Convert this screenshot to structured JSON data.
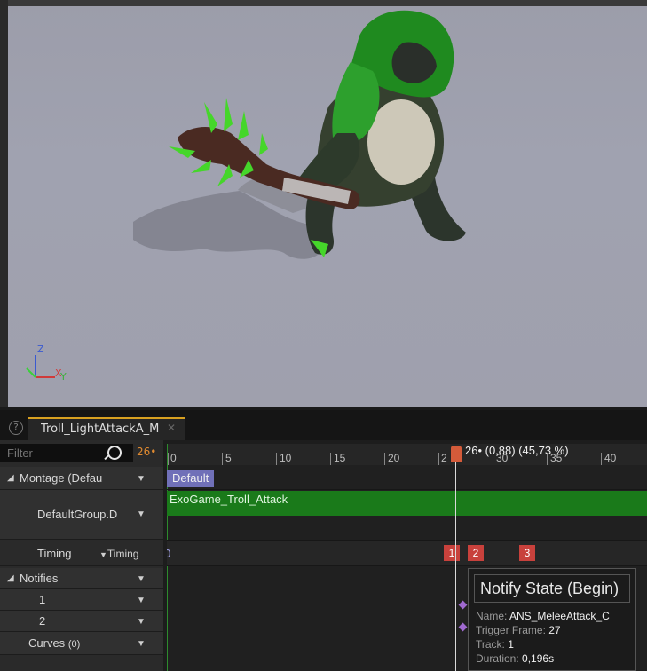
{
  "viewport": {
    "axis_labels": {
      "z": "Z",
      "x": "X",
      "y": "Y"
    }
  },
  "tab": {
    "title": "Troll_LightAttackA_M"
  },
  "filter": {
    "placeholder": "Filter",
    "frame_count": "26•"
  },
  "tracks": {
    "montage": "Montage (Defau",
    "group": "DefaultGroup.D",
    "timing": "Timing",
    "timing_dropdown": "Timing",
    "notifies": "Notifies",
    "notify_1": "1",
    "notify_2": "2",
    "curves": "Curves",
    "curves_count": "(0)"
  },
  "timeline": {
    "ticks": [
      "0",
      "5",
      "10",
      "15",
      "20",
      "2",
      "30",
      "35",
      "40"
    ],
    "scrub_label": "26• (0,88) (45,73 %)",
    "default_section": "Default",
    "slot_anim": "ExoGame_Troll_Attack",
    "timing_zero": "0",
    "timing_markers": [
      "1",
      "2",
      "3"
    ]
  },
  "tooltip": {
    "title": "Notify State (Begin)",
    "name_label": "Name:",
    "name_value": "ANS_MeleeAttack_C",
    "trigger_label": "Trigger Frame:",
    "trigger_value": "27",
    "track_label": "Track:",
    "track_value": "1",
    "duration_label": "Duration:",
    "duration_value": "0,196s"
  },
  "colors": {
    "accent_tab": "#d8a020",
    "section_default": "#7070b8",
    "slot_bar": "#1a7a1a",
    "timing_marker": "#c8413c",
    "scrub_handle": "#d45b3a"
  }
}
